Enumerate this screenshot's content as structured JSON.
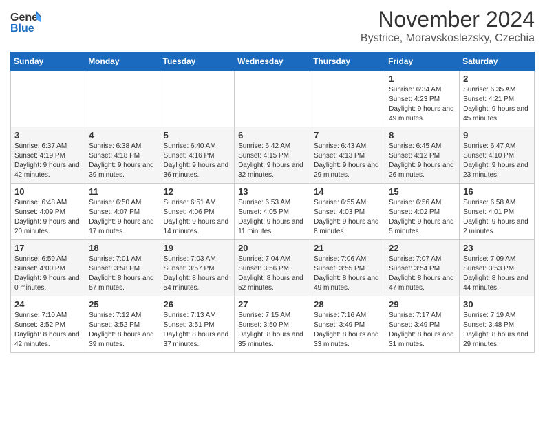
{
  "logo": {
    "line1": "General",
    "line2": "Blue"
  },
  "title": "November 2024",
  "subtitle": "Bystrice, Moravskoslezsky, Czechia",
  "days_of_week": [
    "Sunday",
    "Monday",
    "Tuesday",
    "Wednesday",
    "Thursday",
    "Friday",
    "Saturday"
  ],
  "weeks": [
    [
      {
        "day": "",
        "info": ""
      },
      {
        "day": "",
        "info": ""
      },
      {
        "day": "",
        "info": ""
      },
      {
        "day": "",
        "info": ""
      },
      {
        "day": "",
        "info": ""
      },
      {
        "day": "1",
        "info": "Sunrise: 6:34 AM\nSunset: 4:23 PM\nDaylight: 9 hours and 49 minutes."
      },
      {
        "day": "2",
        "info": "Sunrise: 6:35 AM\nSunset: 4:21 PM\nDaylight: 9 hours and 45 minutes."
      }
    ],
    [
      {
        "day": "3",
        "info": "Sunrise: 6:37 AM\nSunset: 4:19 PM\nDaylight: 9 hours and 42 minutes."
      },
      {
        "day": "4",
        "info": "Sunrise: 6:38 AM\nSunset: 4:18 PM\nDaylight: 9 hours and 39 minutes."
      },
      {
        "day": "5",
        "info": "Sunrise: 6:40 AM\nSunset: 4:16 PM\nDaylight: 9 hours and 36 minutes."
      },
      {
        "day": "6",
        "info": "Sunrise: 6:42 AM\nSunset: 4:15 PM\nDaylight: 9 hours and 32 minutes."
      },
      {
        "day": "7",
        "info": "Sunrise: 6:43 AM\nSunset: 4:13 PM\nDaylight: 9 hours and 29 minutes."
      },
      {
        "day": "8",
        "info": "Sunrise: 6:45 AM\nSunset: 4:12 PM\nDaylight: 9 hours and 26 minutes."
      },
      {
        "day": "9",
        "info": "Sunrise: 6:47 AM\nSunset: 4:10 PM\nDaylight: 9 hours and 23 minutes."
      }
    ],
    [
      {
        "day": "10",
        "info": "Sunrise: 6:48 AM\nSunset: 4:09 PM\nDaylight: 9 hours and 20 minutes."
      },
      {
        "day": "11",
        "info": "Sunrise: 6:50 AM\nSunset: 4:07 PM\nDaylight: 9 hours and 17 minutes."
      },
      {
        "day": "12",
        "info": "Sunrise: 6:51 AM\nSunset: 4:06 PM\nDaylight: 9 hours and 14 minutes."
      },
      {
        "day": "13",
        "info": "Sunrise: 6:53 AM\nSunset: 4:05 PM\nDaylight: 9 hours and 11 minutes."
      },
      {
        "day": "14",
        "info": "Sunrise: 6:55 AM\nSunset: 4:03 PM\nDaylight: 9 hours and 8 minutes."
      },
      {
        "day": "15",
        "info": "Sunrise: 6:56 AM\nSunset: 4:02 PM\nDaylight: 9 hours and 5 minutes."
      },
      {
        "day": "16",
        "info": "Sunrise: 6:58 AM\nSunset: 4:01 PM\nDaylight: 9 hours and 2 minutes."
      }
    ],
    [
      {
        "day": "17",
        "info": "Sunrise: 6:59 AM\nSunset: 4:00 PM\nDaylight: 9 hours and 0 minutes."
      },
      {
        "day": "18",
        "info": "Sunrise: 7:01 AM\nSunset: 3:58 PM\nDaylight: 8 hours and 57 minutes."
      },
      {
        "day": "19",
        "info": "Sunrise: 7:03 AM\nSunset: 3:57 PM\nDaylight: 8 hours and 54 minutes."
      },
      {
        "day": "20",
        "info": "Sunrise: 7:04 AM\nSunset: 3:56 PM\nDaylight: 8 hours and 52 minutes."
      },
      {
        "day": "21",
        "info": "Sunrise: 7:06 AM\nSunset: 3:55 PM\nDaylight: 8 hours and 49 minutes."
      },
      {
        "day": "22",
        "info": "Sunrise: 7:07 AM\nSunset: 3:54 PM\nDaylight: 8 hours and 47 minutes."
      },
      {
        "day": "23",
        "info": "Sunrise: 7:09 AM\nSunset: 3:53 PM\nDaylight: 8 hours and 44 minutes."
      }
    ],
    [
      {
        "day": "24",
        "info": "Sunrise: 7:10 AM\nSunset: 3:52 PM\nDaylight: 8 hours and 42 minutes."
      },
      {
        "day": "25",
        "info": "Sunrise: 7:12 AM\nSunset: 3:52 PM\nDaylight: 8 hours and 39 minutes."
      },
      {
        "day": "26",
        "info": "Sunrise: 7:13 AM\nSunset: 3:51 PM\nDaylight: 8 hours and 37 minutes."
      },
      {
        "day": "27",
        "info": "Sunrise: 7:15 AM\nSunset: 3:50 PM\nDaylight: 8 hours and 35 minutes."
      },
      {
        "day": "28",
        "info": "Sunrise: 7:16 AM\nSunset: 3:49 PM\nDaylight: 8 hours and 33 minutes."
      },
      {
        "day": "29",
        "info": "Sunrise: 7:17 AM\nSunset: 3:49 PM\nDaylight: 8 hours and 31 minutes."
      },
      {
        "day": "30",
        "info": "Sunrise: 7:19 AM\nSunset: 3:48 PM\nDaylight: 8 hours and 29 minutes."
      }
    ]
  ]
}
